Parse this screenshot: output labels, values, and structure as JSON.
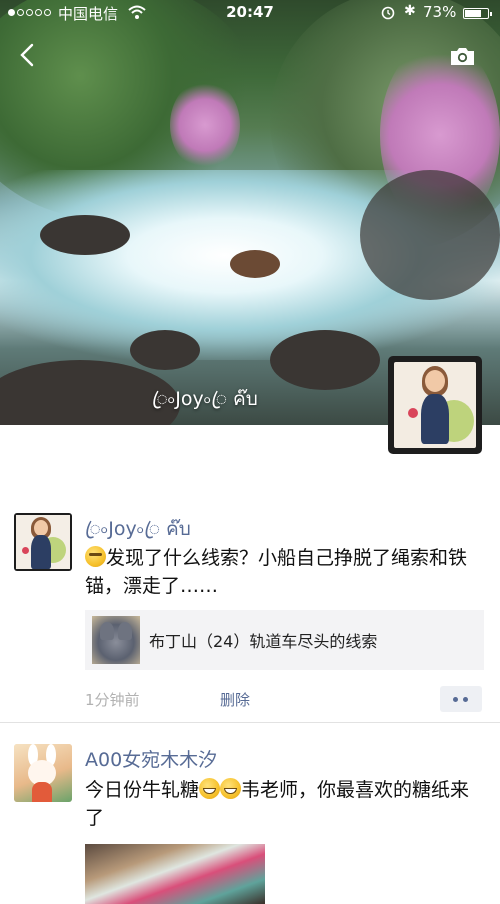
{
  "status_bar": {
    "carrier": "中国电信",
    "time": "20:47",
    "battery": "73%",
    "battery_level": 0.73,
    "bluetooth": "✱"
  },
  "icons": {
    "back": "chevron-left-icon",
    "camera": "camera-icon",
    "wifi": "wifi-icon",
    "alarm": "alarm-icon",
    "more": "more-dots-icon"
  },
  "profile": {
    "cover_name": "ꦿ৹Joy৹ꦿ ค๊บ"
  },
  "posts": [
    {
      "nickname": "ꦿ৹Joy৹ꦿ ค๊บ",
      "text": "发现了什么线索？小船自己挣脱了绳索和铁锚，漂走了……",
      "share": {
        "title": "布丁山（24）轨道车尽头的线索"
      },
      "time": "1分钟前",
      "delete_label": "删除"
    },
    {
      "nickname": "A00女宛木木汐",
      "text_a": "今日份牛轧糖",
      "text_b": "韦老师，你最喜欢的糖纸来了"
    }
  ],
  "colors": {
    "nickname_link": "#576b95",
    "meta_gray": "#b2b2b2",
    "share_bg": "#f3f3f5"
  }
}
